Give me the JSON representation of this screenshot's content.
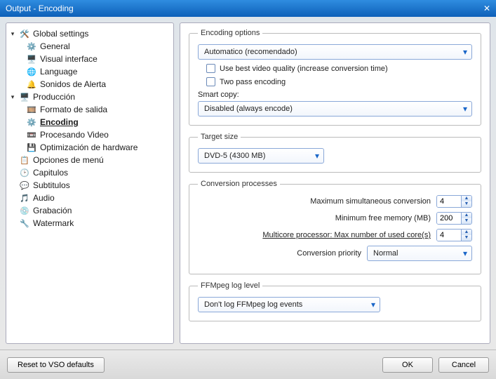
{
  "title": "Output - Encoding",
  "sidebar": {
    "items": [
      {
        "label": "Global settings",
        "expanded": true,
        "children": [
          {
            "label": "General"
          },
          {
            "label": "Visual interface"
          },
          {
            "label": "Language"
          },
          {
            "label": "Sonidos de Alerta"
          }
        ]
      },
      {
        "label": "Producción",
        "expanded": true,
        "children": [
          {
            "label": "Formato de salida"
          },
          {
            "label": "Encoding",
            "selected": true
          },
          {
            "label": "Procesando Video"
          },
          {
            "label": "Optimización de hardware"
          }
        ]
      },
      {
        "label": "Opciones de menú"
      },
      {
        "label": "Capitulos"
      },
      {
        "label": "Subtitulos"
      },
      {
        "label": "Audio"
      },
      {
        "label": "Grabación"
      },
      {
        "label": "Watermark"
      }
    ]
  },
  "encoding_options": {
    "legend": "Encoding options",
    "mode": "Automatico (recomendado)",
    "best_quality": {
      "checked": false,
      "label": "Use best video quality (increase conversion time)"
    },
    "two_pass": {
      "checked": false,
      "label": "Two pass encoding"
    },
    "smart_copy_label": "Smart copy:",
    "smart_copy_value": "Disabled (always encode)"
  },
  "target_size": {
    "legend": "Target size",
    "value": "DVD-5 (4300 MB)"
  },
  "conversion": {
    "legend": "Conversion processes",
    "max_simul_label": "Maximum simultaneous conversion",
    "max_simul_value": "4",
    "min_mem_label": "Minimum free memory (MB)",
    "min_mem_value": "200",
    "multicore_label": "Multicore processor: Max number of used core(s)",
    "multicore_value": "4",
    "priority_label": "Conversion priority",
    "priority_value": "Normal"
  },
  "ffmpeg": {
    "legend": "FFMpeg log level",
    "value": "Don't log FFMpeg log events"
  },
  "footer": {
    "reset": "Reset to VSO defaults",
    "ok": "OK",
    "cancel": "Cancel"
  }
}
